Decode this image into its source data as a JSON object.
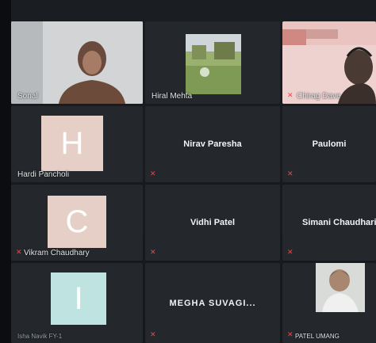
{
  "participants": [
    {
      "name": "Sonal"
    },
    {
      "name": "Hiral Mehta"
    },
    {
      "name": "Chirag Dave"
    },
    {
      "name": "Hardi Pancholi",
      "initial": "H"
    },
    {
      "name": "Nirav Paresha"
    },
    {
      "name": "Paulomi"
    },
    {
      "name": "Vikram Chaudhary",
      "initial": "C"
    },
    {
      "name": "Vidhi Patel"
    },
    {
      "name": "Simani Chaudhari"
    },
    {
      "name": "Isha Navik FY-1",
      "initial": "I"
    },
    {
      "name": "MEGHA SUVAGI..."
    },
    {
      "name": "PATEL UMANG"
    }
  ],
  "colors": {
    "active_speaker_border": "#c8d656",
    "muted_icon": "#e5484d",
    "tile_background": "#24282c"
  }
}
